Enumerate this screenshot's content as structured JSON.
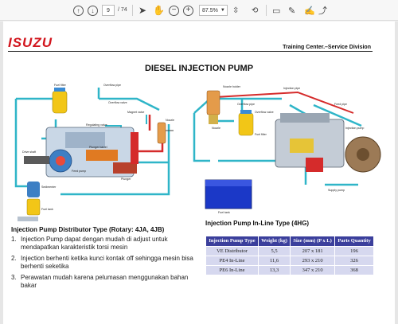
{
  "toolbar": {
    "page_current": "9",
    "page_total": "/ 74",
    "zoom": "87.5%"
  },
  "slide": {
    "logo": "ISUZU",
    "division": "Training Center.–Service Division",
    "title": "DIESEL INJECTION PUMP",
    "left_caption": "Injection Pump Distributor Type (Rotary: 4JA, 4JB)",
    "right_caption": "Injection Pump In-Line Type (4HG)",
    "bullets": [
      {
        "n": "1.",
        "text": "Injection Pump dapat dengan mudah di adjust untuk mendapatkan karakteristik torsi mesin"
      },
      {
        "n": "2.",
        "text": "Injection berhenti ketika kunci kontak off sehingga mesin bisa berhenti seketika"
      },
      {
        "n": "3.",
        "text": "Perawatan mudah karena pelumasan menggunakan bahan bakar"
      }
    ],
    "left_diagram_labels": {
      "fuel_filter": "Fuel filter",
      "overflow_pipe": "Overflow pipe",
      "overflow_valve": "Overflow valve",
      "magnet_valve": "Magnet valve",
      "regulating_valve": "Regulating valve",
      "plunger_barrel": "Plunger barrel",
      "nozzle": "Nozzle",
      "feed_pump": "Feed pump",
      "drive_shaft": "Drive shaft",
      "plunger": "Plunger",
      "sedimenter": "Sedimenter",
      "fuel_tank": "Fuel tank"
    },
    "right_diagram_labels": {
      "nozzle_holder": "Nozzle holder",
      "injection_pipe": "Injection pipe",
      "overflow_pipe": "Overflow pipe",
      "overflow_valve": "Overflow valve",
      "nozzle": "Nozzle",
      "fuel_filter": "Fuel filter",
      "feed_pipe": "Feed pipe",
      "injection_pump": "Injection pump",
      "supply_pump": "Supply pump",
      "fuel_tank": "Fuel tank"
    },
    "table": {
      "headers": [
        "Injection Pump Type",
        "Weight (kg)",
        "Size (mm) (P x L)",
        "Parts Quantity"
      ],
      "rows": [
        [
          "VE Distributor",
          "5,5",
          "207 x 181",
          "196"
        ],
        [
          "PE4 In-Line",
          "11,6",
          "293 x 210",
          "326"
        ],
        [
          "PE6 In-Line",
          "13,3",
          "347 x 210",
          "368"
        ]
      ]
    }
  },
  "colors": {
    "pipe_cyan": "#2fb5c8",
    "pipe_red": "#d52b2b",
    "logo_red": "#d2161e",
    "table_header": "#3b3f9c",
    "table_cell": "#d6d8ef",
    "tank_blue": "#1b38c7",
    "filter_yellow": "#f2c617"
  }
}
